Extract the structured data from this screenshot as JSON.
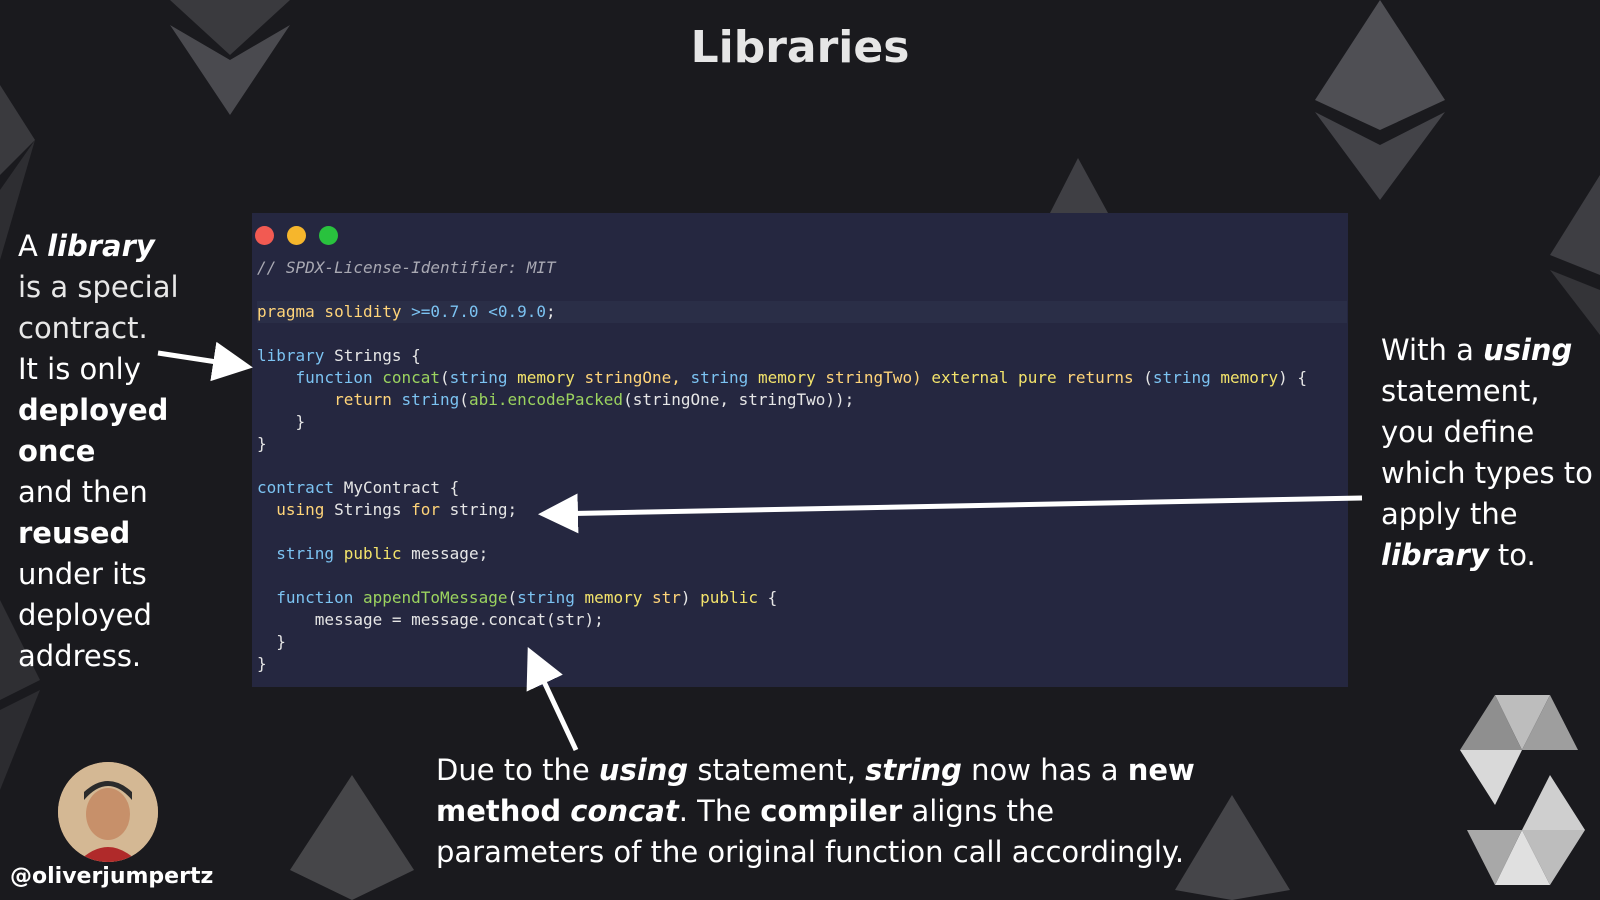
{
  "title": "Libraries",
  "code": {
    "lines": [
      [
        {
          "t": "// SPDX-License-Identifier: MIT",
          "c": "comment"
        }
      ],
      [],
      [
        {
          "t": "pragma solidity ",
          "c": "kw"
        },
        {
          "t": ">=0.7.0 <0.9.0",
          "c": "op"
        },
        {
          "t": ";",
          "c": "plain"
        }
      ],
      [],
      [
        {
          "t": "library ",
          "c": "type"
        },
        {
          "t": "Strings {",
          "c": "plain"
        }
      ],
      [
        {
          "t": "    function ",
          "c": "type"
        },
        {
          "t": "concat",
          "c": "fn"
        },
        {
          "t": "(",
          "c": "plain"
        },
        {
          "t": "string ",
          "c": "type"
        },
        {
          "t": "memory ",
          "c": "mod"
        },
        {
          "t": "stringOne, ",
          "c": "kw"
        },
        {
          "t": "string ",
          "c": "type"
        },
        {
          "t": "memory ",
          "c": "mod"
        },
        {
          "t": "stringTwo) ",
          "c": "kw"
        },
        {
          "t": "external pure ",
          "c": "mod"
        },
        {
          "t": "returns ",
          "c": "kw"
        },
        {
          "t": "(",
          "c": "plain"
        },
        {
          "t": "string ",
          "c": "type"
        },
        {
          "t": "memory",
          "c": "mod"
        },
        {
          "t": ") {",
          "c": "plain"
        }
      ],
      [
        {
          "t": "        return ",
          "c": "kw"
        },
        {
          "t": "string",
          "c": "type"
        },
        {
          "t": "(",
          "c": "plain"
        },
        {
          "t": "abi.encodePacked",
          "c": "fn"
        },
        {
          "t": "(stringOne, stringTwo));",
          "c": "plain"
        }
      ],
      [
        {
          "t": "    }",
          "c": "plain"
        }
      ],
      [
        {
          "t": "}",
          "c": "plain"
        }
      ],
      [],
      [
        {
          "t": "contract ",
          "c": "type"
        },
        {
          "t": "MyContract {",
          "c": "plain"
        }
      ],
      [
        {
          "t": "  using ",
          "c": "kw"
        },
        {
          "t": "Strings ",
          "c": "plain"
        },
        {
          "t": "for ",
          "c": "kw"
        },
        {
          "t": "string;",
          "c": "plain"
        }
      ],
      [],
      [
        {
          "t": "  string ",
          "c": "type"
        },
        {
          "t": "public ",
          "c": "mod"
        },
        {
          "t": "message;",
          "c": "plain"
        }
      ],
      [],
      [
        {
          "t": "  function ",
          "c": "type"
        },
        {
          "t": "appendToMessage",
          "c": "fn"
        },
        {
          "t": "(",
          "c": "plain"
        },
        {
          "t": "string ",
          "c": "type"
        },
        {
          "t": "memory ",
          "c": "mod"
        },
        {
          "t": "str",
          "c": "kw"
        },
        {
          "t": ") ",
          "c": "plain"
        },
        {
          "t": "public ",
          "c": "mod"
        },
        {
          "t": "{",
          "c": "plain"
        }
      ],
      [
        {
          "t": "      message = message.concat(str);",
          "c": "plain"
        }
      ],
      [
        {
          "t": "  }",
          "c": "plain"
        }
      ],
      [
        {
          "t": "}",
          "c": "plain"
        }
      ]
    ]
  },
  "left_annotation": {
    "p1": "A ",
    "library": "library",
    "p2": "is a special contract.",
    "p3": "It is only",
    "deployed_once": "deployed once",
    "p4": "and then",
    "reused": "reused",
    "p5": "under its deployed address."
  },
  "right_annotation": {
    "p1": "With a ",
    "using": "using",
    "p2": "statement, you define which types to apply the",
    "library": "library",
    "p3": " to."
  },
  "bottom_annotation": {
    "p1": "Due to the ",
    "using": "using",
    "p2": " statement, ",
    "string": "string",
    "p3": " now has a ",
    "new_method": "new method",
    "concat": "concat",
    "p4": ". The ",
    "compiler": "compiler",
    "p5": " aligns the parameters of the original function call accordingly."
  },
  "handle": "@oliverjumpertz",
  "colors": {
    "background": "#1a1a1e",
    "code_bg": "#252740",
    "traffic_red": "#f25a52",
    "traffic_yellow": "#f6b62c",
    "traffic_green": "#29c23e"
  },
  "icons": [
    "close-dot-icon",
    "minimize-dot-icon",
    "maximize-dot-icon",
    "solidity-logo-icon",
    "ethereum-logo-icon"
  ]
}
